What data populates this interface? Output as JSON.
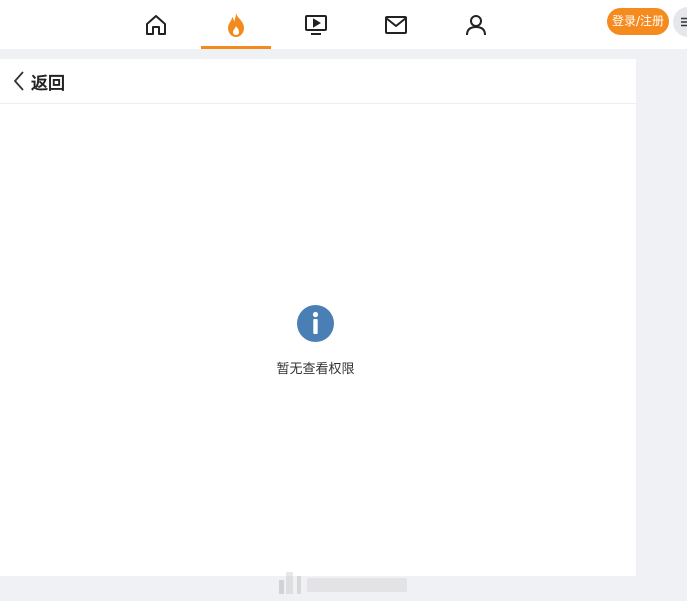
{
  "topnav": {
    "icons": [
      "home-icon",
      "flame-icon",
      "video-icon",
      "mail-icon",
      "user-icon"
    ],
    "active": "flame-icon",
    "login_label": "登录/注册",
    "menu_icon": "menu-icon"
  },
  "page": {
    "back_label": "返回",
    "empty_message": "暂无查看权限",
    "info_icon": "info-icon"
  },
  "colors": {
    "accent": "#f58a1f",
    "info": "#4a7fb5",
    "background": "#f0f1f4"
  }
}
